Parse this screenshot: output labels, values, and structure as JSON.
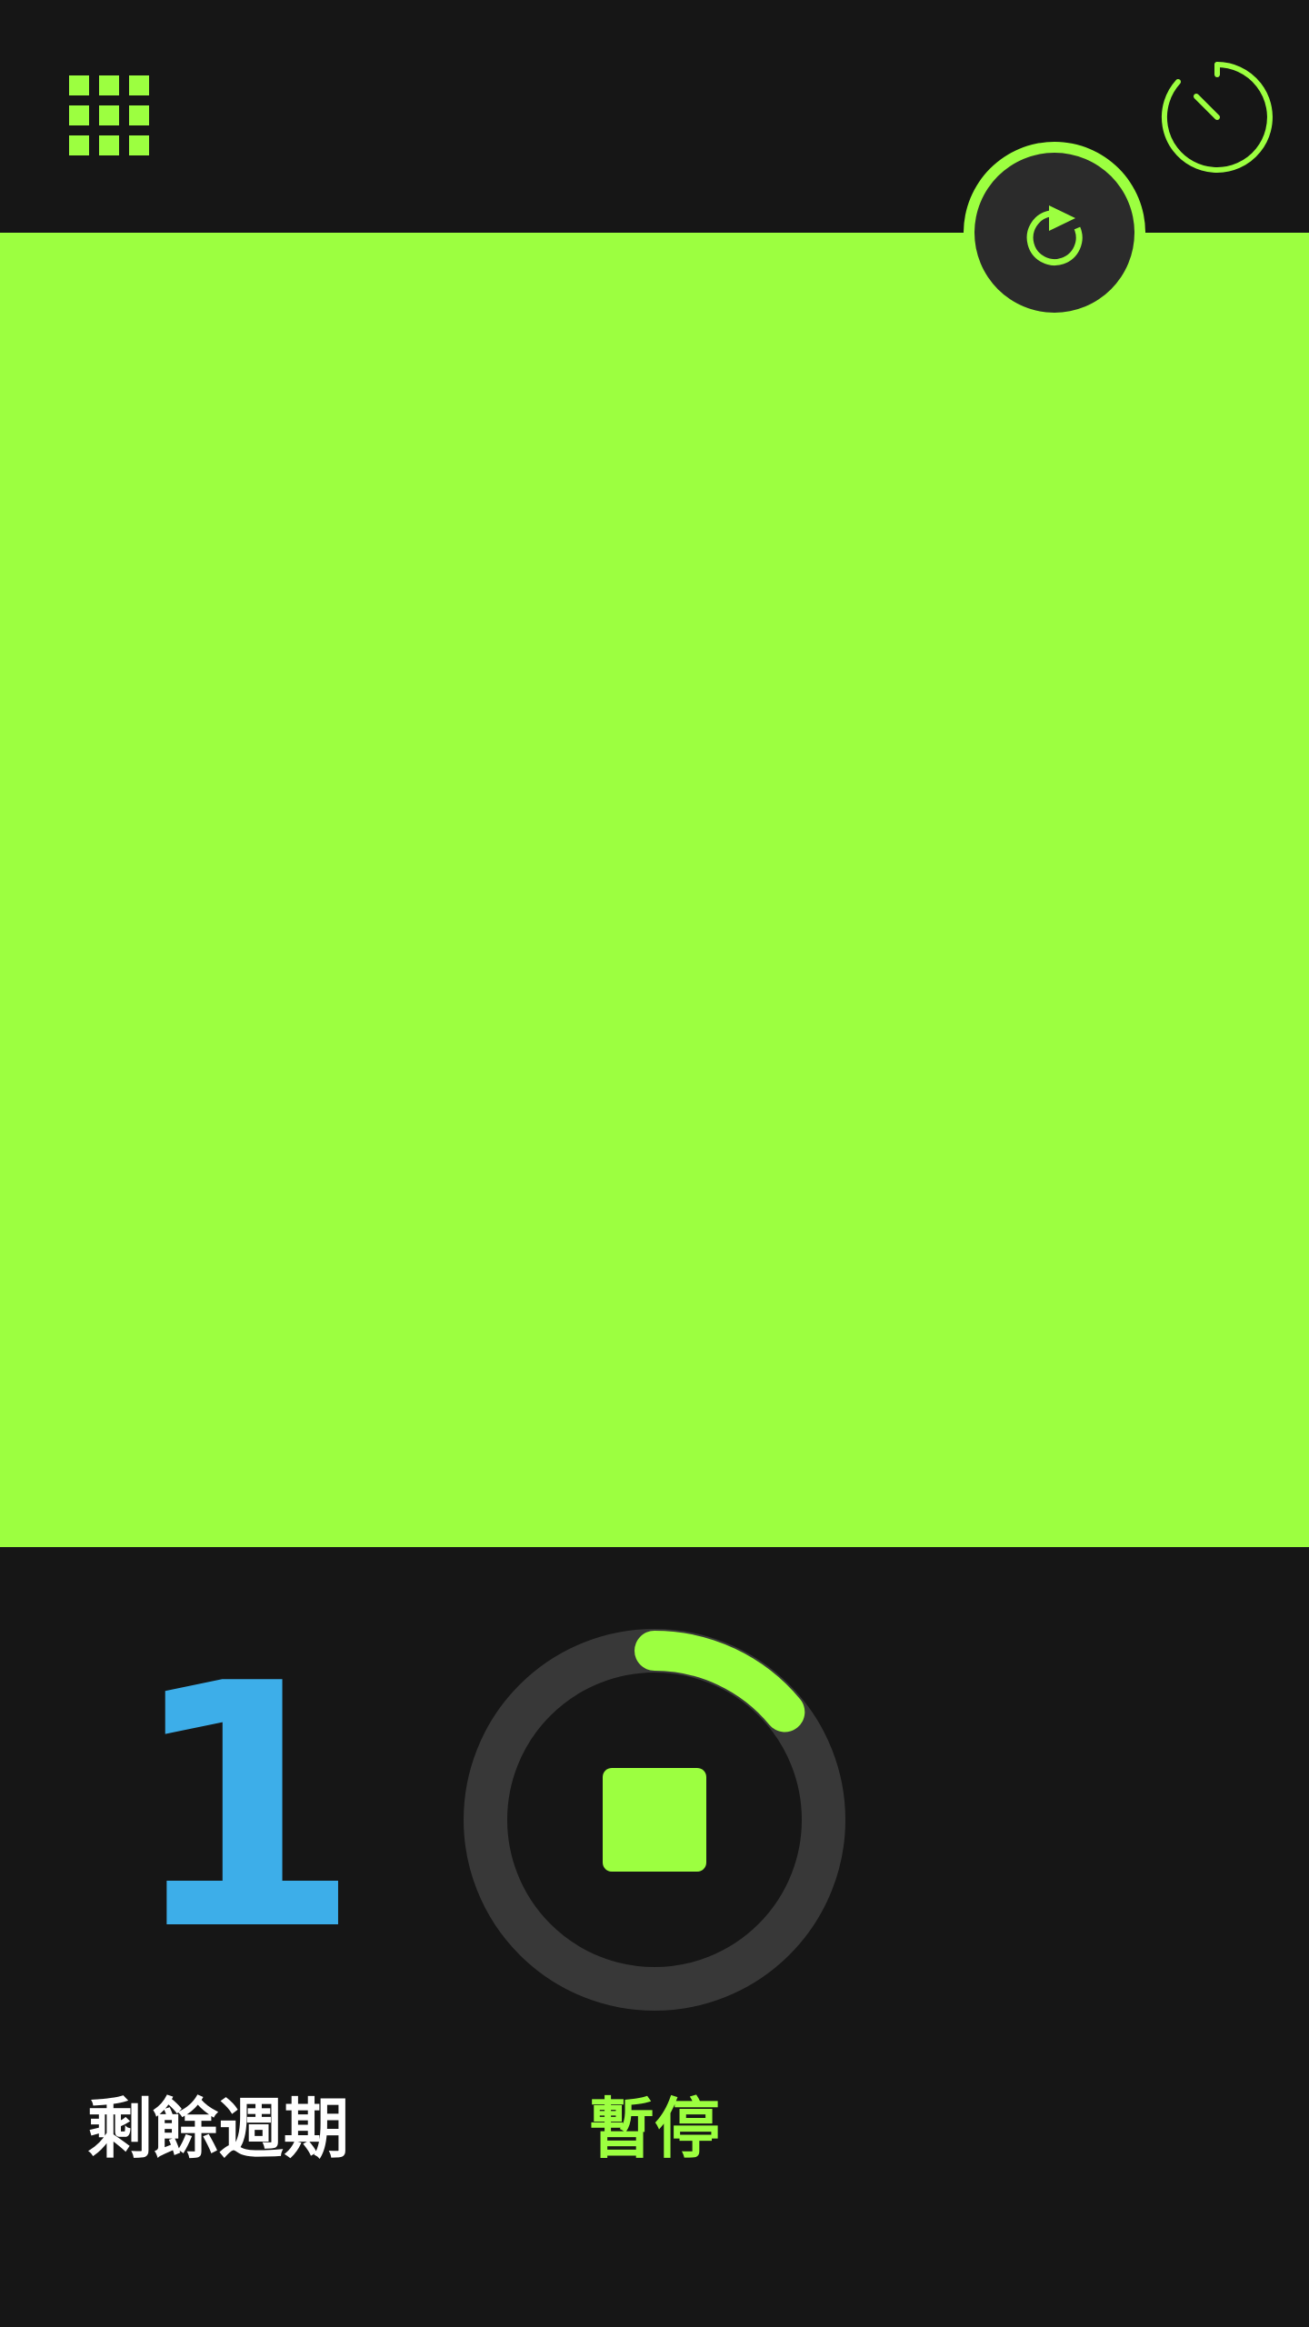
{
  "colors": {
    "accent": "#9cff40",
    "background": "#161616",
    "button_dark": "#2b2b2b",
    "track": "#383838",
    "count": "#3daee9",
    "label": "#ffffff"
  },
  "icons": {
    "menu": "grid-icon",
    "timer": "timer-icon",
    "restart": "restart-icon",
    "stop": "stop-icon"
  },
  "status": {
    "cycles_remaining": "1",
    "cycles_label": "剩餘週期",
    "state_label": "暫停",
    "progress_fraction": 0.14
  }
}
